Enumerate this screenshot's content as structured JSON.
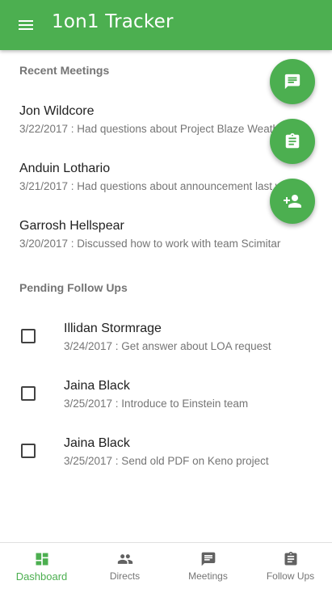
{
  "app": {
    "title": "1on1 Tracker",
    "accent_color": "#4caf50"
  },
  "recent_meetings": {
    "header": "Recent Meetings",
    "items": [
      {
        "name": "Jon Wildcore",
        "description": "3/22/2017 : Had questions about Project Blaze Weather"
      },
      {
        "name": "Anduin Lothario",
        "description": "3/21/2017 : Had questions about announcement last week"
      },
      {
        "name": "Garrosh Hellspear",
        "description": "3/20/2017 : Discussed how to work with team Scimitar"
      }
    ]
  },
  "pending_follow_ups": {
    "header": "Pending Follow Ups",
    "items": [
      {
        "name": "Illidan Stormrage",
        "description": "3/24/2017 : Get answer about LOA request",
        "checked": false
      },
      {
        "name": "Jaina Black",
        "description": "3/25/2017 : Introduce to Einstein team",
        "checked": false
      },
      {
        "name": "Jaina Black",
        "description": "3/25/2017 : Send old PDF on Keno project",
        "checked": false
      }
    ]
  },
  "fabs": [
    {
      "icon": "message-icon"
    },
    {
      "icon": "clipboard-icon"
    },
    {
      "icon": "add-person-icon"
    }
  ],
  "bottom_nav": {
    "items": [
      {
        "label": "Dashboard",
        "icon": "dashboard-icon",
        "active": true
      },
      {
        "label": "Directs",
        "icon": "people-icon",
        "active": false
      },
      {
        "label": "Meetings",
        "icon": "message-icon",
        "active": false
      },
      {
        "label": "Follow Ups",
        "icon": "clipboard-icon",
        "active": false
      }
    ]
  }
}
